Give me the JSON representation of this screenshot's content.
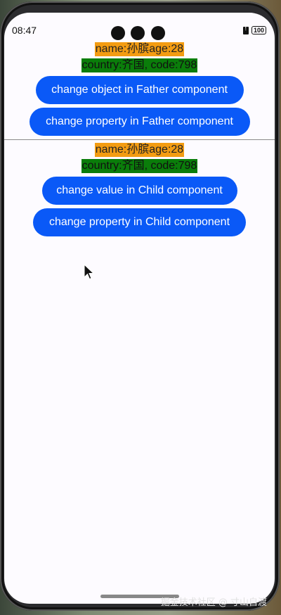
{
  "status_bar": {
    "time": "08:47",
    "battery": "100"
  },
  "father": {
    "name_age": "name:孙膑age:28",
    "country_code": "country:齐国, code:798",
    "change_object_label": "change object in Father component",
    "change_property_label": "change property in Father component"
  },
  "child": {
    "name_age": "name:孙膑age:28",
    "country_code": "country:齐国, code:798",
    "change_value_label": "change value in Child component",
    "change_property_label": "change property in Child component"
  },
  "watermark": "掘金技术社区 @ 寸山自渡",
  "colors": {
    "button": "#0a59f7",
    "orange_label": "#f39c12",
    "green_label": "#0a7d0a"
  }
}
